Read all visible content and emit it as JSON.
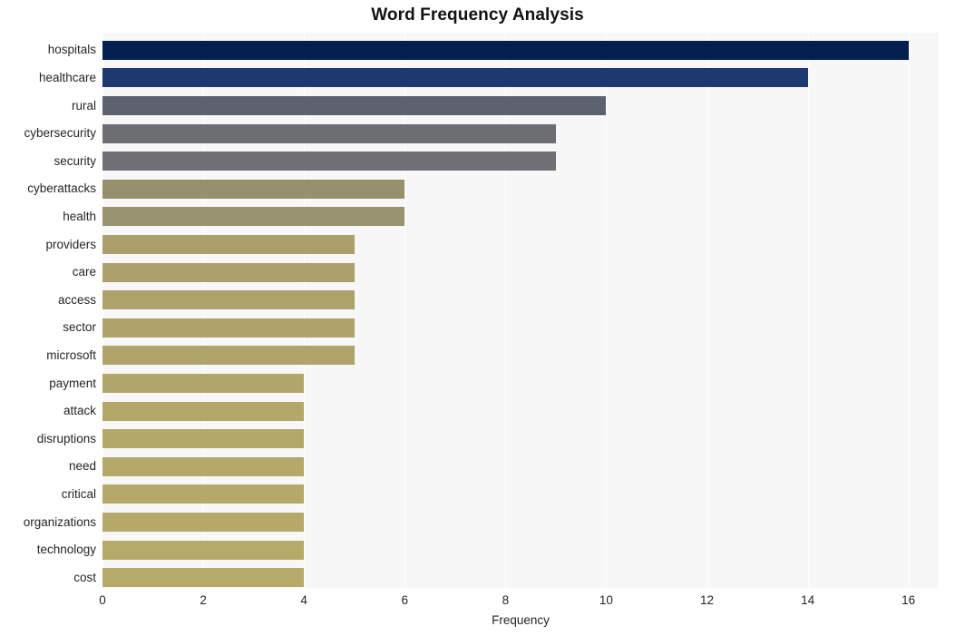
{
  "chart_data": {
    "type": "bar",
    "orientation": "horizontal",
    "title": "Word Frequency Analysis",
    "xlabel": "Frequency",
    "ylabel": "",
    "xlim": [
      0,
      16.6
    ],
    "xticks": [
      0,
      2,
      4,
      6,
      8,
      10,
      12,
      14,
      16
    ],
    "xtick_labels": [
      "0",
      "2",
      "4",
      "6",
      "8",
      "10",
      "12",
      "14",
      "16"
    ],
    "grid": "vertical-only",
    "legend": "none",
    "categories": [
      "hospitals",
      "healthcare",
      "rural",
      "cybersecurity",
      "security",
      "cyberattacks",
      "health",
      "providers",
      "care",
      "access",
      "sector",
      "microsoft",
      "payment",
      "attack",
      "disruptions",
      "need",
      "critical",
      "organizations",
      "technology",
      "cost"
    ],
    "values": [
      16,
      14,
      10,
      9,
      9,
      6,
      6,
      5,
      5,
      5,
      5,
      5,
      4,
      4,
      4,
      4,
      4,
      4,
      4,
      4
    ],
    "bar_colors": [
      "#042050",
      "#1d3a70",
      "#5c6270",
      "#6d6e72",
      "#6f7075",
      "#96906f",
      "#98926f",
      "#ab a06a",
      "#aca16a",
      "#ada26a",
      "#aea36a",
      "#afa46a",
      "#b2a76a",
      "#b3a76a",
      "#b3a86a",
      "#b4a86a",
      "#b4a96a",
      "#b5a96a",
      "#b5aa6a",
      "#b6aa6a"
    ]
  },
  "style": {
    "plot_background": "#f7f7f7",
    "gridline_color": "#ffffff",
    "page_background": "#ffffff",
    "text_color": "#262626",
    "title_color": "#121212"
  }
}
